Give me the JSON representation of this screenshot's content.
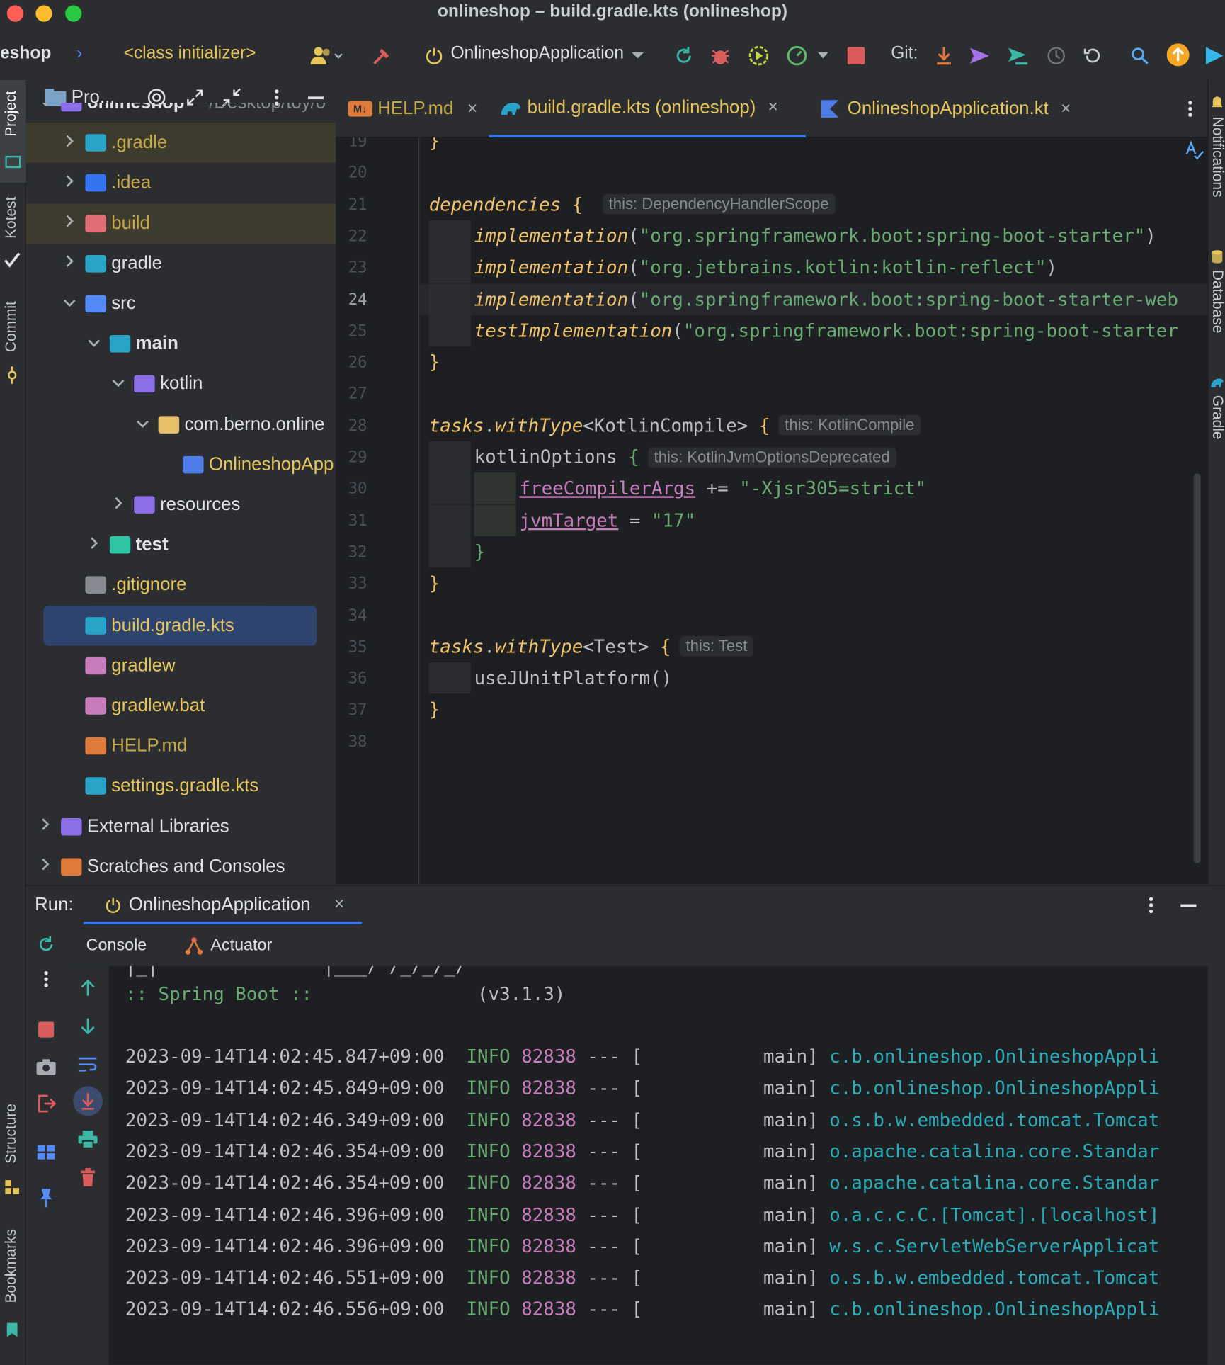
{
  "window": {
    "title": "onlineshop – build.gradle.kts (onlineshop)"
  },
  "toolbar": {
    "breadcrumb_project": "eshop",
    "breadcrumb_separator": "›",
    "breadcrumb_item": "<class initializer>",
    "run_config": "OnlineshopApplication",
    "git_label": "Git:"
  },
  "left_strip": {
    "project_label": "Project",
    "kotest_label": "Kotest",
    "commit_label": "Commit",
    "structure_label": "Structure",
    "bookmarks_label": "Bookmarks"
  },
  "right_strip": {
    "notifications_label": "Notifications",
    "database_label": "Database",
    "gradle_label": "Gradle"
  },
  "project_panel": {
    "header_label": "Pro...",
    "tree": [
      {
        "label": "onlineshop",
        "suffix": "~/Desktop/toy/o",
        "indent": 0,
        "chevron": "⌄",
        "color": "#dfe1e5",
        "bold": true,
        "icon_color": "#8b6ee8",
        "highlight": ""
      },
      {
        "label": ".gradle",
        "indent": 1,
        "chevron": "›",
        "color": "#c5a948",
        "icon_color": "#2aa3c8",
        "highlight": "#3d3b2e"
      },
      {
        "label": ".idea",
        "indent": 1,
        "chevron": "›",
        "color": "#c5a948",
        "icon_color": "#3574f0",
        "highlight": ""
      },
      {
        "label": "build",
        "indent": 1,
        "chevron": "›",
        "color": "#c5a948",
        "icon_color": "#e06c75",
        "highlight": "#3d3b2e"
      },
      {
        "label": "gradle",
        "indent": 1,
        "chevron": "›",
        "color": "#dfe1e5",
        "icon_color": "#2aa3c8",
        "highlight": ""
      },
      {
        "label": "src",
        "indent": 1,
        "chevron": "⌄",
        "color": "#dfe1e5",
        "icon_color": "#548af7",
        "highlight": ""
      },
      {
        "label": "main",
        "indent": 2,
        "chevron": "⌄",
        "color": "#dfe1e5",
        "bold": true,
        "icon_color": "#2aa3c8",
        "highlight": ""
      },
      {
        "label": "kotlin",
        "indent": 3,
        "chevron": "⌄",
        "color": "#dfe1e5",
        "icon_color": "#8b6ee8",
        "highlight": ""
      },
      {
        "label": "com.berno.online",
        "indent": 4,
        "chevron": "⌄",
        "color": "#dfe1e5",
        "icon_color": "#e8c06a",
        "highlight": ""
      },
      {
        "label": "OnlineshopApp",
        "indent": 5,
        "chevron": "",
        "color": "#e6c55a",
        "icon_color": "#4e7ce8",
        "highlight": ""
      },
      {
        "label": "resources",
        "indent": 3,
        "chevron": "›",
        "color": "#dfe1e5",
        "icon_color": "#8b6ee8",
        "highlight": ""
      },
      {
        "label": "test",
        "indent": 2,
        "chevron": "›",
        "color": "#dfe1e5",
        "bold": true,
        "icon_color": "#2ec4a4",
        "highlight": ""
      },
      {
        "label": ".gitignore",
        "indent": 1,
        "chevron": "",
        "color": "#e6c55a",
        "icon_color": "#868a91",
        "highlight": ""
      },
      {
        "label": "build.gradle.kts",
        "indent": 1,
        "chevron": "",
        "color": "#e6c55a",
        "icon_color": "#2aa3c8",
        "highlight": "#2e436e"
      },
      {
        "label": "gradlew",
        "indent": 1,
        "chevron": "",
        "color": "#e6c55a",
        "icon_color": "#c77dbb",
        "highlight": ""
      },
      {
        "label": "gradlew.bat",
        "indent": 1,
        "chevron": "",
        "color": "#e6c55a",
        "icon_color": "#c77dbb",
        "highlight": ""
      },
      {
        "label": "HELP.md",
        "indent": 1,
        "chevron": "",
        "color": "#c5a948",
        "icon_color": "#e07a3b",
        "highlight": ""
      },
      {
        "label": "settings.gradle.kts",
        "indent": 1,
        "chevron": "",
        "color": "#e6c55a",
        "icon_color": "#2aa3c8",
        "highlight": ""
      },
      {
        "label": "External Libraries",
        "indent": 0,
        "chevron": "›",
        "color": "#dfe1e5",
        "icon_color": "#8b6ee8",
        "highlight": ""
      },
      {
        "label": "Scratches and Consoles",
        "indent": 0,
        "chevron": "›",
        "color": "#dfe1e5",
        "icon_color": "#e07a3b",
        "highlight": ""
      }
    ]
  },
  "tabs": [
    {
      "label": "HELP.md",
      "icon": "markdown-icon",
      "color": "#c5a948",
      "active": false
    },
    {
      "label": "build.gradle.kts (onlineshop)",
      "icon": "gradle-icon",
      "color": "#e6c55a",
      "active": true
    },
    {
      "label": "OnlineshopApplication.kt",
      "icon": "kotlin-icon",
      "color": "#e6c55a",
      "active": false
    }
  ],
  "editor": {
    "current_line": "24",
    "lines": [
      {
        "no": "19",
        "code": [
          {
            "t": "}",
            "c": "brace"
          }
        ]
      },
      {
        "no": "20",
        "code": []
      },
      {
        "no": "21",
        "code": [
          {
            "t": "dependencies",
            "c": "it"
          },
          {
            "t": " { ",
            "c": "brace"
          }
        ],
        "hint": "this: DependencyHandlerScope"
      },
      {
        "no": "22",
        "indent": 1,
        "code": [
          {
            "t": "implementation",
            "c": "it"
          },
          {
            "t": "(",
            "c": "plain"
          },
          {
            "t": "\"org.springframework.boot:spring-boot-starter\"",
            "c": "str"
          },
          {
            "t": ")",
            "c": "plain"
          }
        ]
      },
      {
        "no": "23",
        "indent": 1,
        "code": [
          {
            "t": "implementation",
            "c": "it"
          },
          {
            "t": "(",
            "c": "plain"
          },
          {
            "t": "\"org.jetbrains.kotlin:kotlin-reflect\"",
            "c": "str"
          },
          {
            "t": ")",
            "c": "plain"
          }
        ]
      },
      {
        "no": "24",
        "indent": 1,
        "code": [
          {
            "t": "implementation",
            "c": "it"
          },
          {
            "t": "(",
            "c": "plain"
          },
          {
            "t": "\"org.springframework.boot:spring-boot-starter-web",
            "c": "str"
          }
        ]
      },
      {
        "no": "25",
        "indent": 1,
        "code": [
          {
            "t": "testImplementation",
            "c": "it"
          },
          {
            "t": "(",
            "c": "plain"
          },
          {
            "t": "\"org.springframework.boot:spring-boot-starter",
            "c": "str"
          }
        ]
      },
      {
        "no": "26",
        "code": [
          {
            "t": "}",
            "c": "brace"
          }
        ]
      },
      {
        "no": "27",
        "code": []
      },
      {
        "no": "28",
        "code": [
          {
            "t": "tasks",
            "c": "it"
          },
          {
            "t": ".",
            "c": "plain"
          },
          {
            "t": "withType",
            "c": "it"
          },
          {
            "t": "<KotlinCompile> ",
            "c": "plain"
          },
          {
            "t": "{",
            "c": "brace"
          }
        ],
        "hint": "this: KotlinCompile"
      },
      {
        "no": "29",
        "indent": 1,
        "code": [
          {
            "t": "kotlinOptions",
            "c": "plain"
          },
          {
            "t": " {",
            "c": "str"
          }
        ],
        "hint": "this: KotlinJvmOptionsDeprecated"
      },
      {
        "no": "30",
        "indent": 2,
        "code": [
          {
            "t": "freeCompilerArgs",
            "c": "ul"
          },
          {
            "t": " += ",
            "c": "plain"
          },
          {
            "t": "\"-Xjsr305=strict\"",
            "c": "str"
          }
        ]
      },
      {
        "no": "31",
        "indent": 2,
        "code": [
          {
            "t": "jvmTarget",
            "c": "ul"
          },
          {
            "t": " = ",
            "c": "plain"
          },
          {
            "t": "\"17\"",
            "c": "str"
          }
        ]
      },
      {
        "no": "32",
        "indent": 1,
        "code": [
          {
            "t": "}",
            "c": "str"
          }
        ]
      },
      {
        "no": "33",
        "code": [
          {
            "t": "}",
            "c": "brace"
          }
        ]
      },
      {
        "no": "34",
        "code": []
      },
      {
        "no": "35",
        "code": [
          {
            "t": "tasks",
            "c": "it"
          },
          {
            "t": ".",
            "c": "plain"
          },
          {
            "t": "withType",
            "c": "it"
          },
          {
            "t": "<Test> ",
            "c": "plain"
          },
          {
            "t": "{",
            "c": "brace"
          }
        ],
        "hint": "this: Test"
      },
      {
        "no": "36",
        "indent": 1,
        "code": [
          {
            "t": "useJUnitPlatform()",
            "c": "plain"
          }
        ]
      },
      {
        "no": "37",
        "code": [
          {
            "t": "}",
            "c": "brace"
          }
        ]
      },
      {
        "no": "38",
        "code": []
      }
    ]
  },
  "run_panel": {
    "run_label": "Run:",
    "run_tab": "OnlineshopApplication",
    "console_tab": "Console",
    "actuator_tab": "Actuator",
    "banner_left": ":: Spring Boot ::",
    "banner_version": "(v3.1.3)",
    "banner_ascii": "|_|               |___/ /_/_/_/",
    "logs": [
      {
        "ts": "2023-09-14T14:02:45.847+09:00",
        "level": "INFO",
        "pid": "82838",
        "thread": "main]",
        "logger": "c.b.onlineshop.OnlineshopAppli"
      },
      {
        "ts": "2023-09-14T14:02:45.849+09:00",
        "level": "INFO",
        "pid": "82838",
        "thread": "main]",
        "logger": "c.b.onlineshop.OnlineshopAppli"
      },
      {
        "ts": "2023-09-14T14:02:46.349+09:00",
        "level": "INFO",
        "pid": "82838",
        "thread": "main]",
        "logger": "o.s.b.w.embedded.tomcat.Tomcat"
      },
      {
        "ts": "2023-09-14T14:02:46.354+09:00",
        "level": "INFO",
        "pid": "82838",
        "thread": "main]",
        "logger": "o.apache.catalina.core.Standar"
      },
      {
        "ts": "2023-09-14T14:02:46.354+09:00",
        "level": "INFO",
        "pid": "82838",
        "thread": "main]",
        "logger": "o.apache.catalina.core.Standar"
      },
      {
        "ts": "2023-09-14T14:02:46.396+09:00",
        "level": "INFO",
        "pid": "82838",
        "thread": "main]",
        "logger": "o.a.c.c.C.[Tomcat].[localhost]"
      },
      {
        "ts": "2023-09-14T14:02:46.396+09:00",
        "level": "INFO",
        "pid": "82838",
        "thread": "main]",
        "logger": "w.s.c.ServletWebServerApplicat"
      },
      {
        "ts": "2023-09-14T14:02:46.551+09:00",
        "level": "INFO",
        "pid": "82838",
        "thread": "main]",
        "logger": "o.s.b.w.embedded.tomcat.Tomcat"
      },
      {
        "ts": "2023-09-14T14:02:46.556+09:00",
        "level": "INFO",
        "pid": "82838",
        "thread": "main]",
        "logger": "c.b.onlineshop.OnlineshopAppli"
      }
    ]
  },
  "colors": {
    "accent": "#3574f0",
    "selection": "#2e436e",
    "stop_red": "#db5c5c",
    "yellow_text": "#e6c55a"
  }
}
